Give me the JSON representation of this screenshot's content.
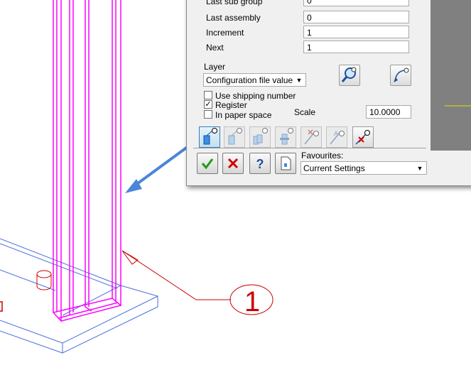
{
  "fields": [
    {
      "label": "Last sub group",
      "value": "0"
    },
    {
      "label": "Last assembly",
      "value": "0"
    },
    {
      "label": "Increment",
      "value": "1"
    },
    {
      "label": "Next",
      "value": "1"
    }
  ],
  "layer": {
    "label": "Layer",
    "selected": "Configuration file value"
  },
  "options": {
    "use_shipping_number": {
      "label": "Use shipping number",
      "checked": false
    },
    "register": {
      "label": "Register",
      "checked": true
    },
    "in_paper_space": {
      "label": "In paper space",
      "checked": false
    }
  },
  "scale": {
    "label": "Scale",
    "value": "10.0000"
  },
  "favourites": {
    "label": "Favourites:",
    "selected": "Current Settings"
  },
  "tools": [
    "tag-object",
    "tag-attached",
    "tag-repeat",
    "tag-group",
    "tag-cross",
    "tag-text",
    "tag-delete"
  ],
  "drawing": {
    "balloon_label": "1",
    "balloon_color": "#cc0000",
    "member_color": "#ff00ff",
    "plate_color": "#4a6fe0",
    "arrow_color": "#4a86d8"
  }
}
